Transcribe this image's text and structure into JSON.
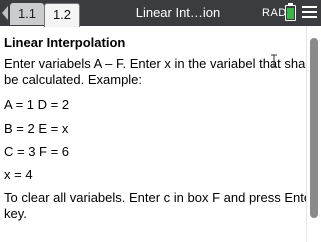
{
  "header": {
    "tabs": [
      {
        "label": "1.1",
        "active": false
      },
      {
        "label": "1.2",
        "active": true
      }
    ],
    "document_title": "Linear Int…ion",
    "mode": "RAD",
    "battery_level": 0.9
  },
  "content": {
    "title": "Linear Interpolation",
    "lines": [
      "Enter variabels A – F. Enter x in the variabel that shall",
      "be calculated. Example:",
      "A = 1   D = 2",
      "B = 2   E = x",
      "C = 3   F = 6",
      "x = 4",
      "To clear all variabels. Enter c in box F and press Enter",
      "key."
    ]
  },
  "colors": {
    "titlebar_bg": "#3a3c3f",
    "battery_green": "#39b54a"
  },
  "icons": [
    "back-arrow-icon",
    "battery-icon",
    "menu-icon",
    "text-cursor-icon"
  ]
}
